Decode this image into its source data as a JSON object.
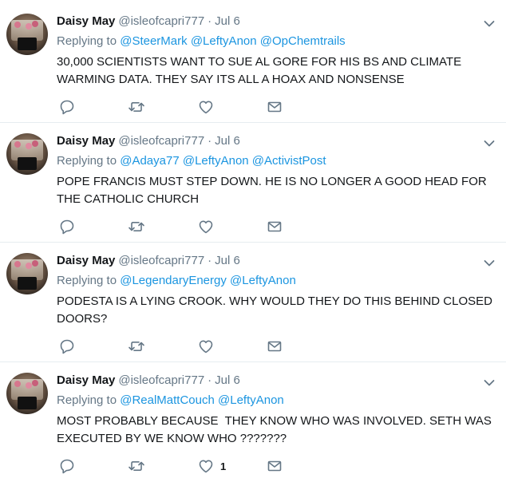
{
  "icons": {
    "reply": "reply-icon",
    "retweet": "retweet-icon",
    "like": "heart-icon",
    "dm": "mail-icon",
    "more": "chevron-down-icon"
  },
  "colors": {
    "link": "#1b95e0",
    "meta": "#657786",
    "icon": "#657786",
    "text": "#14171a",
    "divider": "#e6ecf0"
  },
  "tweets": [
    {
      "name": "Daisy May",
      "handle": "@isleofcapri777",
      "dot": "·",
      "date": "Jul 6",
      "replying_label": "Replying to",
      "mentions": [
        "@SteerMark",
        "@LeftyAnon",
        "@OpChemtrails"
      ],
      "text": "30,000 SCIENTISTS WANT TO SUE AL GORE FOR HIS BS AND CLIMATE WARMING DATA. THEY SAY ITS ALL A HOAX AND NONSENSE",
      "like_count": ""
    },
    {
      "name": "Daisy May",
      "handle": "@isleofcapri777",
      "dot": "·",
      "date": "Jul 6",
      "replying_label": "Replying to",
      "mentions": [
        "@Adaya77",
        "@LeftyAnon",
        "@ActivistPost"
      ],
      "text": "POPE FRANCIS MUST STEP DOWN. HE IS NO LONGER A GOOD HEAD FOR THE CATHOLIC CHURCH",
      "like_count": ""
    },
    {
      "name": "Daisy May",
      "handle": "@isleofcapri777",
      "dot": "·",
      "date": "Jul 6",
      "replying_label": "Replying to",
      "mentions": [
        "@LegendaryEnergy",
        "@LeftyAnon"
      ],
      "text": "PODESTA IS A LYING CROOK. WHY WOULD THEY DO THIS BEHIND CLOSED DOORS?",
      "like_count": ""
    },
    {
      "name": "Daisy May",
      "handle": "@isleofcapri777",
      "dot": "·",
      "date": "Jul 6",
      "replying_label": "Replying to",
      "mentions": [
        "@RealMattCouch",
        "@LeftyAnon"
      ],
      "text": "MOST PROBABLY BECAUSE  THEY KNOW WHO WAS INVOLVED. SETH WAS EXECUTED BY WE KNOW WHO ???????",
      "like_count": "1"
    }
  ]
}
